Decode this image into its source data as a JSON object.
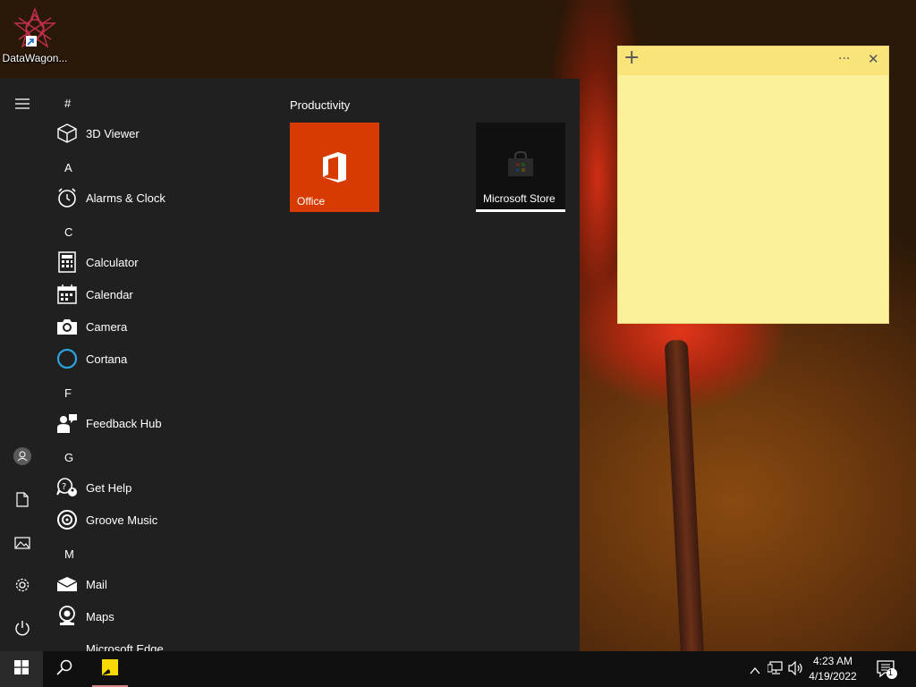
{
  "desktop": {
    "icons": [
      {
        "label": "DataWagon...",
        "icon": "datawagon-logo-icon"
      }
    ]
  },
  "start_menu": {
    "rail": [
      {
        "icon": "hamburger-menu-icon"
      },
      {
        "icon": "user-avatar-icon"
      },
      {
        "icon": "documents-icon"
      },
      {
        "icon": "pictures-icon"
      },
      {
        "icon": "settings-gear-icon"
      },
      {
        "icon": "power-icon"
      }
    ],
    "app_list": {
      "letters": [
        "#",
        "A",
        "C",
        "F",
        "G",
        "M"
      ],
      "apps": [
        {
          "label": "3D Viewer",
          "icon": "cube-icon"
        },
        {
          "label": "Alarms & Clock",
          "icon": "alarm-clock-icon"
        },
        {
          "label": "Calculator",
          "icon": "calculator-icon"
        },
        {
          "label": "Calendar",
          "icon": "calendar-icon"
        },
        {
          "label": "Camera",
          "icon": "camera-icon"
        },
        {
          "label": "Cortana",
          "icon": "cortana-ring-icon"
        },
        {
          "label": "Feedback Hub",
          "icon": "feedback-hub-icon"
        },
        {
          "label": "Get Help",
          "icon": "get-help-icon"
        },
        {
          "label": "Groove Music",
          "icon": "groove-music-icon"
        },
        {
          "label": "Mail",
          "icon": "mail-icon"
        },
        {
          "label": "Maps",
          "icon": "maps-icon"
        },
        {
          "label": "Microsoft Edge",
          "icon": "edge-icon"
        }
      ]
    },
    "tiles": {
      "group_title": "Productivity",
      "items": [
        {
          "label": "Office",
          "icon": "office-logo-icon",
          "bg": "#d83b01"
        },
        {
          "label": "Microsoft Store",
          "icon": "store-bag-icon",
          "bg": "#101010"
        }
      ]
    }
  },
  "sticky_note": {
    "add_glyph": "+",
    "menu_glyph": "···",
    "close_glyph": "✕",
    "content": ""
  },
  "taskbar": {
    "start_icon": "windows-logo-icon",
    "search_icon": "search-icon",
    "pinned": [
      {
        "icon": "sticky-notes-icon",
        "active": true
      }
    ],
    "tray_icons": [
      "chevron-up-icon",
      "network-icon",
      "volume-icon"
    ],
    "time": "4:23 AM",
    "date": "4/19/2022",
    "notification_count": "1"
  },
  "colors": {
    "start_bg": "#202020",
    "office_tile": "#d83b01",
    "sticky_yellow": "#fdf09b",
    "taskbar_bg": "#101010",
    "cortana_blue": "#2aa3e0"
  }
}
